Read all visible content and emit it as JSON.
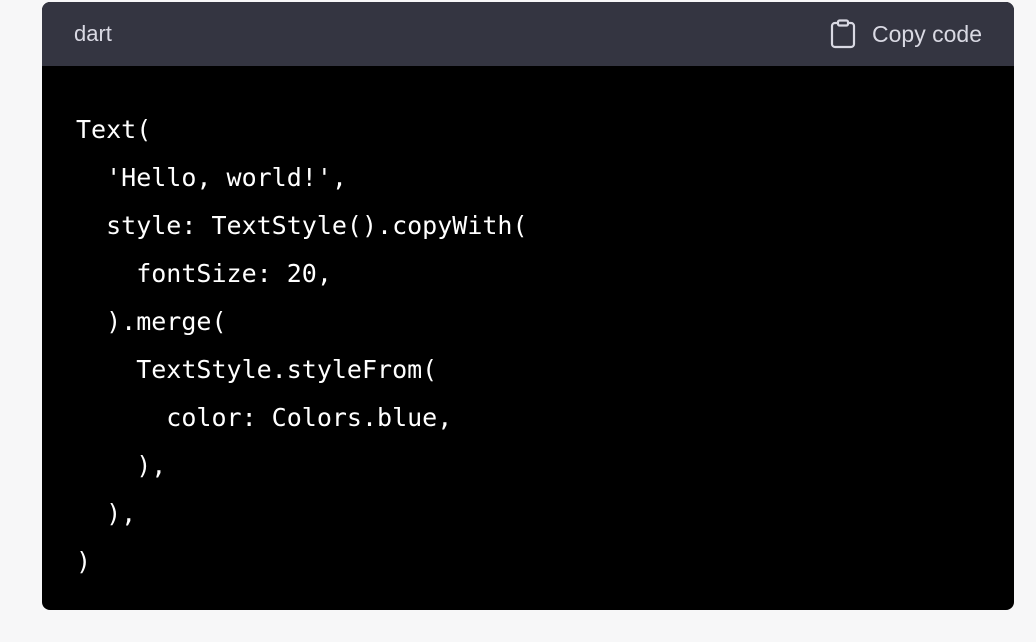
{
  "code_block": {
    "language": "dart",
    "copy_label": "Copy code",
    "copy_icon": "clipboard-icon",
    "code": "Text(\n  'Hello, world!',\n  style: TextStyle().copyWith(\n    fontSize: 20,\n  ).merge(\n    TextStyle.styleFrom(\n      color: Colors.blue,\n    ),\n  ),\n)"
  },
  "colors": {
    "page_background": "#f7f7f8",
    "header_background": "#343541",
    "code_background": "#000000",
    "header_text": "#d9d9e3",
    "code_text": "#ffffff"
  }
}
